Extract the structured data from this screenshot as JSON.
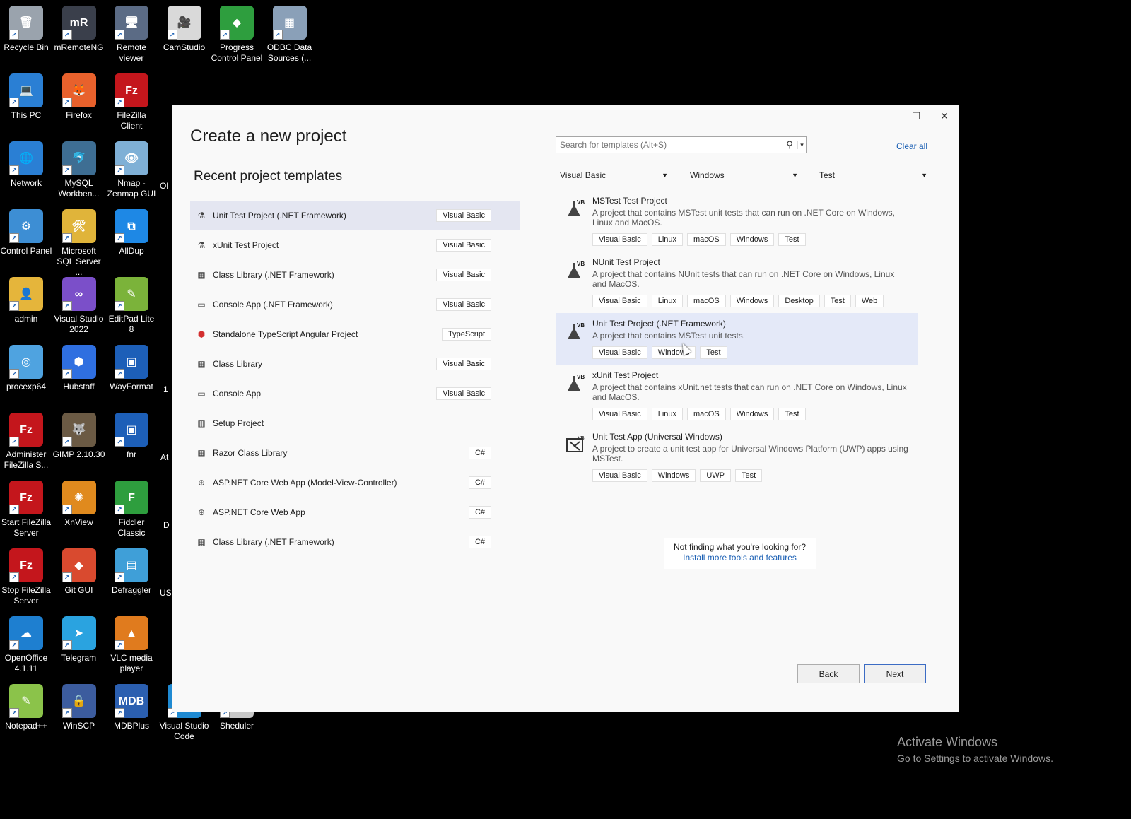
{
  "desktop": {
    "icons": [
      {
        "label": "Recycle Bin",
        "color": "#9aa3ad",
        "glyph": "🗑"
      },
      {
        "label": "mRemoteNG",
        "color": "#3a3f4b",
        "glyph": "mR"
      },
      {
        "label": "Remote viewer",
        "color": "#5b6b85",
        "glyph": "🖥"
      },
      {
        "label": "CamStudio",
        "color": "#d9d9d9",
        "glyph": "🎥"
      },
      {
        "label": "Progress Control Panel",
        "color": "#2e9e3e",
        "glyph": "◆"
      },
      {
        "label": "ODBC Data Sources (...",
        "color": "#8aa0b8",
        "glyph": "▦"
      },
      {
        "label": "This PC",
        "color": "#2a7fd4",
        "glyph": "💻"
      },
      {
        "label": "Firefox",
        "color": "#e8612c",
        "glyph": "🦊"
      },
      {
        "label": "FileZilla Client",
        "color": "#c4161c",
        "glyph": "Fz"
      },
      {
        "label": "Network",
        "color": "#2a7fd4",
        "glyph": "🌐"
      },
      {
        "label": "MySQL Workben...",
        "color": "#3e6e93",
        "glyph": "🐬"
      },
      {
        "label": "Nmap - Zenmap GUI",
        "color": "#7fb0d6",
        "glyph": "👁"
      },
      {
        "label": "Control Panel",
        "color": "#3d8ed4",
        "glyph": "⚙"
      },
      {
        "label": "Microsoft SQL Server ...",
        "color": "#e0b43a",
        "glyph": "🛠"
      },
      {
        "label": "AllDup",
        "color": "#1e88e5",
        "glyph": "⧉"
      },
      {
        "label": "admin",
        "color": "#e5b53b",
        "glyph": "👤"
      },
      {
        "label": "Visual Studio 2022",
        "color": "#7b4fc9",
        "glyph": "∞"
      },
      {
        "label": "EditPad Lite 8",
        "color": "#7bb33a",
        "glyph": "✎"
      },
      {
        "label": "procexp64",
        "color": "#4fa3e0",
        "glyph": "◎"
      },
      {
        "label": "Hubstaff",
        "color": "#2f6fe0",
        "glyph": "⬢"
      },
      {
        "label": "WayFormat",
        "color": "#1d5fb8",
        "glyph": "▣"
      },
      {
        "label": "Administer FileZilla S...",
        "color": "#c4161c",
        "glyph": "Fz"
      },
      {
        "label": "GIMP 2.10.30",
        "color": "#6b5a44",
        "glyph": "🐺"
      },
      {
        "label": "fnr",
        "color": "#1d5fb8",
        "glyph": "▣"
      },
      {
        "label": "Start FileZilla Server",
        "color": "#c4161c",
        "glyph": "Fz"
      },
      {
        "label": "XnView",
        "color": "#e08a1e",
        "glyph": "✺"
      },
      {
        "label": "Fiddler Classic",
        "color": "#2e9e3e",
        "glyph": "F"
      },
      {
        "label": "Stop FileZilla Server",
        "color": "#c4161c",
        "glyph": "Fz"
      },
      {
        "label": "Git GUI",
        "color": "#d94a2f",
        "glyph": "◆"
      },
      {
        "label": "Defraggler",
        "color": "#3f9fd8",
        "glyph": "▤"
      },
      {
        "label": "OpenOffice 4.1.11",
        "color": "#1e7fd0",
        "glyph": "☁"
      },
      {
        "label": "Telegram",
        "color": "#2aa3e0",
        "glyph": "➤"
      },
      {
        "label": "VLC media player",
        "color": "#e07b1e",
        "glyph": "▲"
      },
      {
        "label": "Notepad++",
        "color": "#8bc34a",
        "glyph": "✎"
      },
      {
        "label": "WinSCP",
        "color": "#3c5c9e",
        "glyph": "🔒"
      },
      {
        "label": "MDBPlus",
        "color": "#2b5fb0",
        "glyph": "MDB"
      },
      {
        "label": "Visual Studio Code",
        "color": "#1f8ad2",
        "glyph": "⟩"
      },
      {
        "label": "Sheduler",
        "color": "#c8c8c8",
        "glyph": "🕑"
      }
    ],
    "partial_labels": [
      "Ol",
      "1",
      "At",
      "D",
      "US"
    ]
  },
  "dialog": {
    "title": "Create a new project",
    "recent_title": "Recent project templates",
    "recent": [
      {
        "name": "Unit Test Project (.NET Framework)",
        "lang": "Visual Basic",
        "icon": "⚗"
      },
      {
        "name": "xUnit Test Project",
        "lang": "Visual Basic",
        "icon": "⚗"
      },
      {
        "name": "Class Library (.NET Framework)",
        "lang": "Visual Basic",
        "icon": "▦"
      },
      {
        "name": "Console App (.NET Framework)",
        "lang": "Visual Basic",
        "icon": "▭"
      },
      {
        "name": "Standalone TypeScript Angular Project",
        "lang": "TypeScript",
        "icon": "⬢"
      },
      {
        "name": "Class Library",
        "lang": "Visual Basic",
        "icon": "▦"
      },
      {
        "name": "Console App",
        "lang": "Visual Basic",
        "icon": "▭"
      },
      {
        "name": "Setup Project",
        "lang": "",
        "icon": "▥"
      },
      {
        "name": "Razor Class Library",
        "lang": "C#",
        "icon": "▦"
      },
      {
        "name": "ASP.NET Core Web App (Model-View-Controller)",
        "lang": "C#",
        "icon": "⊕"
      },
      {
        "name": "ASP.NET Core Web App",
        "lang": "C#",
        "icon": "⊕"
      },
      {
        "name": "Class Library (.NET Framework)",
        "lang": "C#",
        "icon": "▦"
      }
    ],
    "search_placeholder": "Search for templates (Alt+S)",
    "clear_all": "Clear all",
    "filters": {
      "language": "Visual Basic",
      "platform": "Windows",
      "project_type": "Test"
    },
    "templates": [
      {
        "name": "MSTest Test Project",
        "desc": "A project that contains MSTest unit tests that can run on .NET Core on Windows, Linux and MacOS.",
        "tags": [
          "Visual Basic",
          "Linux",
          "macOS",
          "Windows",
          "Test"
        ],
        "icon": "flask-vb"
      },
      {
        "name": "NUnit Test Project",
        "desc": "A project that contains NUnit tests that can run on .NET Core on Windows, Linux and MacOS.",
        "tags": [
          "Visual Basic",
          "Linux",
          "macOS",
          "Windows",
          "Desktop",
          "Test",
          "Web"
        ],
        "icon": "flask-vb"
      },
      {
        "name": "Unit Test Project (.NET Framework)",
        "desc": "A project that contains MSTest unit tests.",
        "tags": [
          "Visual Basic",
          "Windows",
          "Test"
        ],
        "icon": "flask-vb"
      },
      {
        "name": "xUnit Test Project",
        "desc": "A project that contains xUnit.net tests that can run on .NET Core on Windows, Linux and MacOS.",
        "tags": [
          "Visual Basic",
          "Linux",
          "macOS",
          "Windows",
          "Test"
        ],
        "icon": "flask-vb"
      },
      {
        "name": "Unit Test App (Universal Windows)",
        "desc": "A project to create a unit test app for Universal Windows Platform (UWP) apps using MSTest.",
        "tags": [
          "Visual Basic",
          "Windows",
          "UWP",
          "Test"
        ],
        "icon": "uwp-test"
      }
    ],
    "not_finding": "Not finding what you're looking for?",
    "install_link": "Install more tools and features",
    "back": "Back",
    "next": "Next"
  },
  "watermark": {
    "line1": "Activate Windows",
    "line2": "Go to Settings to activate Windows."
  }
}
